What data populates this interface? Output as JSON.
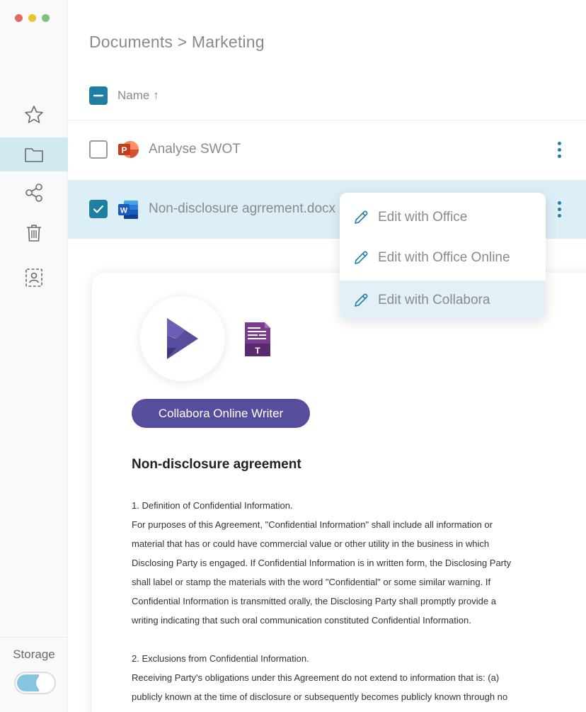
{
  "window": {
    "traffic_colors": [
      "#e06b63",
      "#e8c42e",
      "#7fc17e"
    ]
  },
  "sidebar": {
    "items": [
      {
        "name": "favorites",
        "icon": "star-icon"
      },
      {
        "name": "files",
        "icon": "folder-icon",
        "active": true
      },
      {
        "name": "shared",
        "icon": "share-icon"
      },
      {
        "name": "trash",
        "icon": "trash-icon"
      },
      {
        "name": "contacts",
        "icon": "contact-icon"
      }
    ],
    "storage_label": "Storage",
    "storage_fill_fraction": 0.6
  },
  "breadcrumb": "Documents > Marketing",
  "list": {
    "name_header": "Name ↑",
    "rows": [
      {
        "name": "Analyse SWOT",
        "type": "powerpoint",
        "checked": false
      },
      {
        "name": "Non-disclosure agrrement.docx",
        "type": "word",
        "checked": true
      }
    ]
  },
  "context_menu": {
    "items": [
      {
        "label": "Edit with Office"
      },
      {
        "label": "Edit with Office Online"
      },
      {
        "label": "Edit with Collabora",
        "hover": true
      }
    ]
  },
  "preview": {
    "badge": "Collabora Online Writer",
    "writer_icon_letter": "T",
    "title": "Non-disclosure agreement",
    "lines": [
      "1. Definition of Confidential Information.",
      "For purposes of this Agreement, \"Confidential Information\" shall include all information or",
      "material that has or could have commercial value or other utility in the business in which",
      "Disclosing Party is engaged. If Confidential Information is in written form, the Disclosing Party",
      "shall label or stamp the materials with the word \"Confidential\" or some similar warning. If",
      "Confidential Information is transmitted orally, the Disclosing Party shall promptly provide a",
      "writing indicating that such oral communication constituted Confidential Information.",
      "",
      "2. Exclusions from Confidential Information.",
      "Receiving Party's obligations under this Agreement do not extend to information that is: (a)",
      "publicly known at the time of disclosure or subsequently becomes publicly known through no"
    ]
  },
  "colors": {
    "accent": "#1e7fa3",
    "selected_row": "#dceef6",
    "collabora_purple": "#574d9d"
  }
}
